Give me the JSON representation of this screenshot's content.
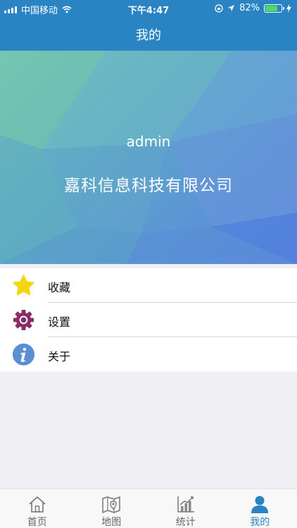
{
  "status": {
    "carrier": "中国移动",
    "time": "下午4:47",
    "battery": "82%",
    "battery_level": 0.82
  },
  "nav": {
    "title": "我的"
  },
  "profile": {
    "username": "admin",
    "company": "嘉科信息科技有限公司"
  },
  "menu": {
    "items": [
      {
        "label": "收藏",
        "icon": "star-icon"
      },
      {
        "label": "设置",
        "icon": "gear-icon"
      },
      {
        "label": "关于",
        "icon": "info-icon"
      }
    ]
  },
  "tabs": [
    {
      "label": "首页",
      "icon": "home-icon",
      "active": false
    },
    {
      "label": "地图",
      "icon": "map-icon",
      "active": false
    },
    {
      "label": "统计",
      "icon": "chart-icon",
      "active": false
    },
    {
      "label": "我的",
      "icon": "person-icon",
      "active": true
    }
  ],
  "colors": {
    "primary": "#2a84c3",
    "star": "#f5d60e",
    "gear": "#8a2c68",
    "info": "#5a8fd4"
  }
}
